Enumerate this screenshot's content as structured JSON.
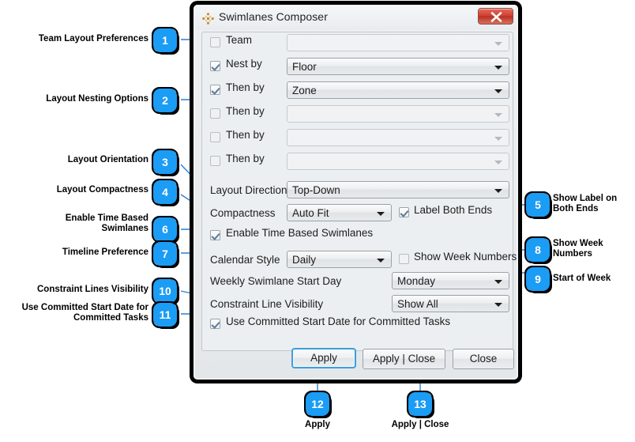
{
  "window": {
    "title": "Swimlanes Composer",
    "icon": "swimlane-diamond-icon",
    "close_label": "x",
    "accent": "#1b9cf5"
  },
  "form": {
    "rows": [
      {
        "name": "team",
        "checkbox_label": "Team",
        "checked": false,
        "enabled": false,
        "value": ""
      },
      {
        "name": "nest-by",
        "checkbox_label": "Nest by",
        "checked": true,
        "enabled": true,
        "value": "Floor"
      },
      {
        "name": "then-by-1",
        "checkbox_label": "Then by",
        "checked": true,
        "enabled": true,
        "value": "Zone"
      },
      {
        "name": "then-by-2",
        "checkbox_label": "Then by",
        "checked": false,
        "enabled": false,
        "value": ""
      },
      {
        "name": "then-by-3",
        "checkbox_label": "Then by",
        "checked": false,
        "enabled": false,
        "value": ""
      },
      {
        "name": "then-by-4",
        "checkbox_label": "Then by",
        "checked": false,
        "enabled": false,
        "value": ""
      }
    ],
    "layout_direction": {
      "label": "Layout Direction",
      "value": "Top-Down"
    },
    "compactness": {
      "label": "Compactness",
      "value": "Auto Fit"
    },
    "label_both_ends": {
      "label": "Label Both Ends",
      "checked": true
    },
    "enable_time_based": {
      "label": "Enable Time Based Swimlanes",
      "checked": true
    },
    "calendar_style": {
      "label": "Calendar Style",
      "value": "Daily"
    },
    "show_week_numbers": {
      "label": "Show Week Numbers",
      "checked": false
    },
    "weekly_start_day": {
      "label": "Weekly Swimlane Start Day",
      "value": "Monday"
    },
    "constraint_line_visibility": {
      "label": "Constraint Line Visibility",
      "value": "Show All"
    },
    "use_committed_start": {
      "label": "Use Committed Start Date for Committed Tasks",
      "checked": true
    }
  },
  "buttons": {
    "apply": "Apply",
    "apply_close": "Apply | Close",
    "close": "Close"
  },
  "annotations": [
    {
      "num": "1",
      "text": "Team Layout Preferences"
    },
    {
      "num": "2",
      "text": "Layout Nesting Options"
    },
    {
      "num": "3",
      "text": "Layout Orientation"
    },
    {
      "num": "4",
      "text": "Layout Compactness"
    },
    {
      "num": "5",
      "text": "Show Label on\nBoth Ends"
    },
    {
      "num": "6",
      "text": "Enable Time Based\nSwimlanes"
    },
    {
      "num": "7",
      "text": "Timeline Preference"
    },
    {
      "num": "8",
      "text": "Show Week\nNumbers"
    },
    {
      "num": "9",
      "text": "Start of Week"
    },
    {
      "num": "10",
      "text": "Constraint Lines Visibility"
    },
    {
      "num": "11",
      "text": "Use Committed Start Date for\nCommitted Tasks"
    },
    {
      "num": "12",
      "text": "Apply"
    },
    {
      "num": "13",
      "text": "Apply | Close"
    }
  ]
}
